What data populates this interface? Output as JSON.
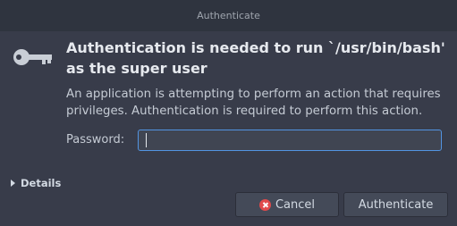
{
  "window": {
    "title": "Authenticate"
  },
  "dialog": {
    "icon": "key-icon",
    "heading": "Authentication is needed to run `/usr/bin/bash' as the super user",
    "description": "An application is attempting to perform an action that requires privileges. Authentication is required to perform this action.",
    "password_label": "Password:",
    "password_value": "",
    "details_label": "Details"
  },
  "buttons": {
    "cancel_label": "Cancel",
    "cancel_icon": "cancel-icon",
    "authenticate_label": "Authenticate"
  },
  "colors": {
    "accent": "#5294e2",
    "dialog_bg": "#383c4a",
    "titlebar_bg": "#2f343f",
    "cancel_icon": "#e14b4b"
  }
}
